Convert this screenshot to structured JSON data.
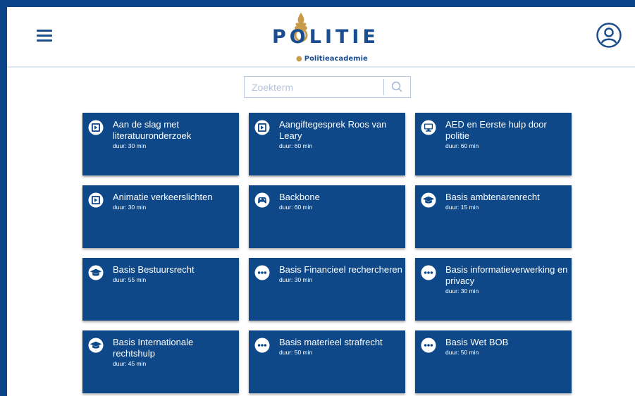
{
  "header": {
    "logo_text": "POLITIE",
    "logo_subtitle": "Politieacademie",
    "menu_icon": "hamburger-menu-icon",
    "account_icon": "user-circle-icon"
  },
  "search": {
    "placeholder": "Zoekterm",
    "value": "",
    "button_icon": "search-icon"
  },
  "colors": {
    "brand_blue": "#0e4888",
    "logo_blue": "#1a4d91",
    "logo_gold": "#c79b4a",
    "border": "#b9c9e1"
  },
  "courses": [
    {
      "title": "Aan de slag met literatuuronderzoek",
      "duration": "duur: 30 min",
      "icon": "play-icon"
    },
    {
      "title": "Aangiftegesprek Roos van Leary",
      "duration": "duur: 60 min",
      "icon": "play-icon"
    },
    {
      "title": "AED en Eerste hulp door politie",
      "duration": "duur: 60 min",
      "icon": "monitor-icon"
    },
    {
      "title": "Animatie verkeerslichten",
      "duration": "duur: 30 min",
      "icon": "play-icon"
    },
    {
      "title": "Backbone",
      "duration": "duur: 60 min",
      "icon": "gamepad-icon"
    },
    {
      "title": "Basis ambtenarenrecht",
      "duration": "duur: 15 min",
      "icon": "graduation-cap-icon"
    },
    {
      "title": "Basis Bestuursrecht",
      "duration": "duur: 55 min",
      "icon": "graduation-cap-icon"
    },
    {
      "title": "Basis Financieel rechercheren",
      "duration": "duur: 30 min",
      "icon": "more-dots-icon"
    },
    {
      "title": "Basis informatieverwerking en privacy",
      "duration": "duur: 30 min",
      "icon": "more-dots-icon"
    },
    {
      "title": "Basis Internationale rechtshulp",
      "duration": "duur: 45 min",
      "icon": "graduation-cap-icon"
    },
    {
      "title": "Basis materieel strafrecht",
      "duration": "duur: 50 min",
      "icon": "more-dots-icon"
    },
    {
      "title": "Basis Wet BOB",
      "duration": "duur: 50 min",
      "icon": "more-dots-icon"
    }
  ]
}
